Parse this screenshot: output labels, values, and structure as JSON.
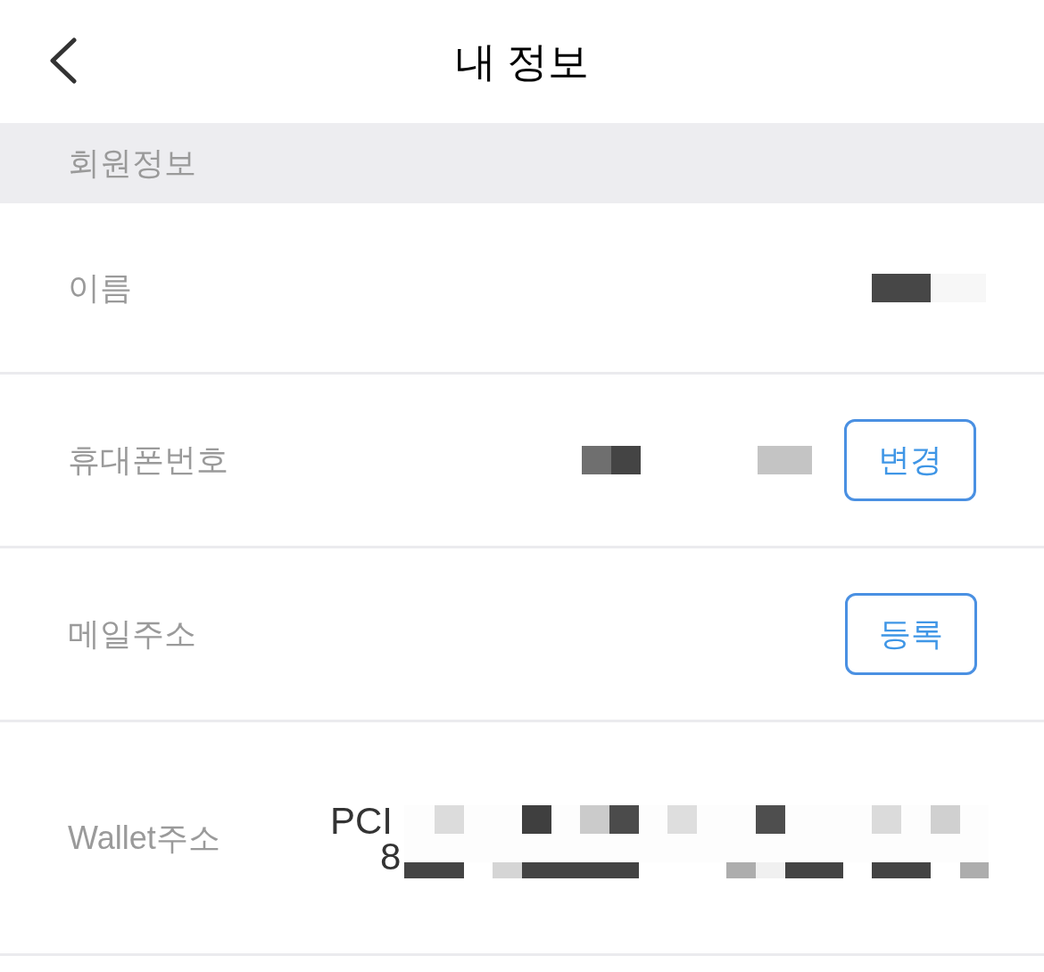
{
  "header": {
    "title": "내 정보"
  },
  "section": {
    "title": "회원정보"
  },
  "rows": [
    {
      "kind": "masked",
      "label": "이름"
    },
    {
      "kind": "masked-button",
      "label": "휴대폰번호",
      "button": "변경"
    },
    {
      "kind": "button",
      "label": "메일주소",
      "button": "등록"
    },
    {
      "kind": "wallet",
      "label": "Wallet주소",
      "value_lines": [
        "PCI",
        "8"
      ]
    }
  ]
}
